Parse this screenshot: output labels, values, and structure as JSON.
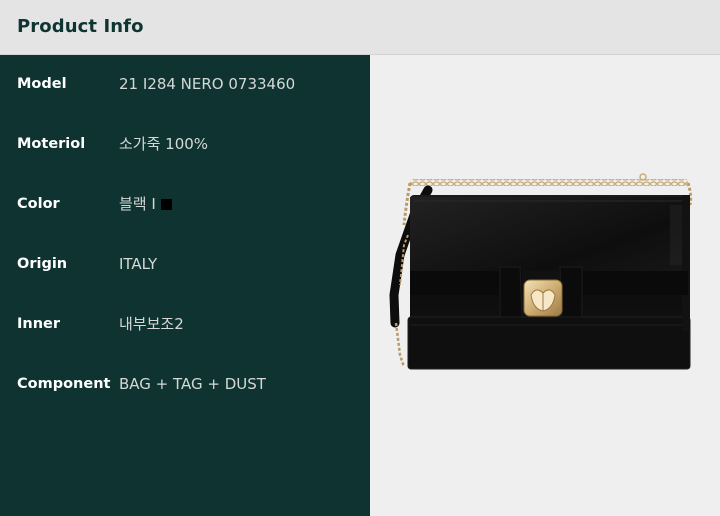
{
  "header": {
    "title": "Product Info"
  },
  "product_info": {
    "rows": [
      {
        "label": "Model",
        "value": "21 I284 NERO 0733460"
      },
      {
        "label": "Moteriol",
        "value": "소가죽 100%"
      },
      {
        "label": "Color",
        "value": "블랙 I",
        "swatch_color": "#000000"
      },
      {
        "label": "Origin",
        "value": "ITALY"
      },
      {
        "label": "Inner",
        "value": "내부보조2"
      },
      {
        "label": "Component",
        "value": "BAG + TAG + DUST"
      }
    ]
  },
  "colors": {
    "header_bg": "#e4e4e4",
    "header_text": "#0f3533",
    "panel_bg": "#0f3331",
    "image_bg": "#efefef"
  }
}
